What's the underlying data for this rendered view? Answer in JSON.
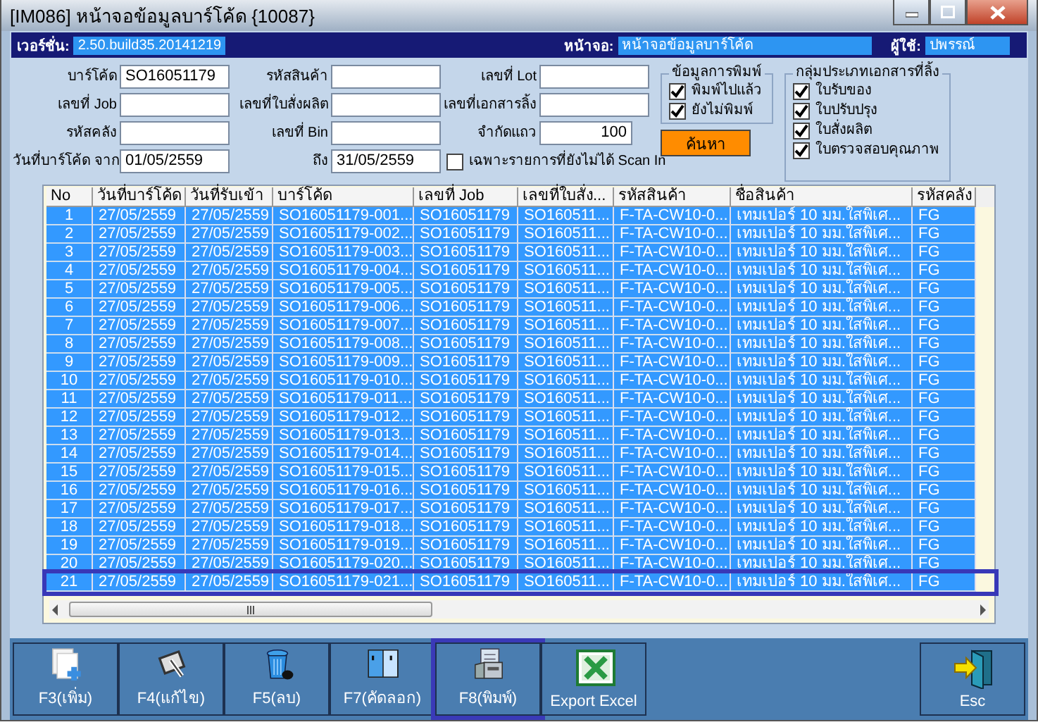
{
  "window": {
    "title": "[IM086] หน้าจอข้อมูลบาร์โค้ด {10087}"
  },
  "info_bar": [
    {
      "label": "เวอร์ชั่น:",
      "value": "2.50.build35.20141219"
    },
    {
      "label": "หน้าจอ:",
      "value": "หน้าจอข้อมูลบาร์โค้ด"
    },
    {
      "label": "ผู้ใช้:",
      "value": "ปพรรณ์"
    }
  ],
  "filters": [
    {
      "kind": "field",
      "label": "บาร์โค้ด",
      "value": "SO16051179"
    },
    {
      "kind": "field",
      "label": "รหัสสินค้า"
    },
    {
      "kind": "field",
      "label": "เลขที่ Lot"
    },
    {
      "kind": "field",
      "label": "เลขที่ Job"
    },
    {
      "kind": "field",
      "label": "เลขที่ใบสั่งผลิต"
    },
    {
      "kind": "field",
      "label": "เลขที่เอกสารลิ้ง"
    },
    {
      "kind": "field",
      "label": "รหัสคลัง"
    },
    {
      "kind": "field",
      "label": "เลขที่ Bin"
    },
    {
      "kind": "number",
      "label": "จำกัดแถว",
      "value": "100"
    },
    {
      "kind": "field",
      "label": "วันที่บาร์โค้ด จาก",
      "value": "01/05/2559"
    },
    {
      "kind": "field",
      "label": "ถึง",
      "value": "31/05/2559"
    },
    {
      "kind": "checkbox",
      "label": "เฉพาะรายการที่ยังไม่ได้ Scan In",
      "checked": false
    }
  ],
  "print_status": {
    "title": "ข้อมูลการพิมพ์",
    "options": [
      {
        "label": "พิมพ์ไปแล้ว",
        "checked": true
      },
      {
        "label": "ยังไม่พิมพ์",
        "checked": true
      }
    ]
  },
  "search_button": "ค้นหา",
  "document_types": {
    "title": "กลุ่มประเภทเอกสารที่ลิ้ง",
    "options": [
      {
        "label": "ใบรับของ",
        "checked": true
      },
      {
        "label": "ใบปรับปรุง",
        "checked": true
      },
      {
        "label": "ใบสั่งผลิต",
        "checked": true
      },
      {
        "label": "ใบตรวจสอบคุณภาพ",
        "checked": true
      }
    ]
  },
  "grid": {
    "columns": [
      "No",
      "วันที่บาร์โค้ด",
      "วันที่รับเข้า",
      "บาร์โค้ด",
      "เลขที่ Job",
      "เลขที่ใบสั่ง...",
      "รหัสสินค้า",
      "ชื่อสินค้า",
      "รหัสคลัง"
    ],
    "rows": [
      {
        "cells": [
          "1",
          "27/05/2559",
          "27/05/2559",
          "SO16051179-001...",
          "SO16051179",
          "SO160511...",
          "F-TA-CW10-0...",
          "เทมเปอร์ 10 มม.ใสพิเศ...",
          "FG"
        ],
        "selected": true,
        "highlighted": false
      },
      {
        "cells": [
          "2",
          "27/05/2559",
          "27/05/2559",
          "SO16051179-002...",
          "SO16051179",
          "SO160511...",
          "F-TA-CW10-0...",
          "เทมเปอร์ 10 มม.ใสพิเศ...",
          "FG"
        ],
        "selected": true,
        "highlighted": false
      },
      {
        "cells": [
          "3",
          "27/05/2559",
          "27/05/2559",
          "SO16051179-003...",
          "SO16051179",
          "SO160511...",
          "F-TA-CW10-0...",
          "เทมเปอร์ 10 มม.ใสพิเศ...",
          "FG"
        ],
        "selected": true,
        "highlighted": false
      },
      {
        "cells": [
          "4",
          "27/05/2559",
          "27/05/2559",
          "SO16051179-004...",
          "SO16051179",
          "SO160511...",
          "F-TA-CW10-0...",
          "เทมเปอร์ 10 มม.ใสพิเศ...",
          "FG"
        ],
        "selected": true,
        "highlighted": false
      },
      {
        "cells": [
          "5",
          "27/05/2559",
          "27/05/2559",
          "SO16051179-005...",
          "SO16051179",
          "SO160511...",
          "F-TA-CW10-0...",
          "เทมเปอร์ 10 มม.ใสพิเศ...",
          "FG"
        ],
        "selected": true,
        "highlighted": false
      },
      {
        "cells": [
          "6",
          "27/05/2559",
          "27/05/2559",
          "SO16051179-006...",
          "SO16051179",
          "SO160511...",
          "F-TA-CW10-0...",
          "เทมเปอร์ 10 มม.ใสพิเศ...",
          "FG"
        ],
        "selected": true,
        "highlighted": false
      },
      {
        "cells": [
          "7",
          "27/05/2559",
          "27/05/2559",
          "SO16051179-007...",
          "SO16051179",
          "SO160511...",
          "F-TA-CW10-0...",
          "เทมเปอร์ 10 มม.ใสพิเศ...",
          "FG"
        ],
        "selected": true,
        "highlighted": false
      },
      {
        "cells": [
          "8",
          "27/05/2559",
          "27/05/2559",
          "SO16051179-008...",
          "SO16051179",
          "SO160511...",
          "F-TA-CW10-0...",
          "เทมเปอร์ 10 มม.ใสพิเศ...",
          "FG"
        ],
        "selected": true,
        "highlighted": false
      },
      {
        "cells": [
          "9",
          "27/05/2559",
          "27/05/2559",
          "SO16051179-009...",
          "SO16051179",
          "SO160511...",
          "F-TA-CW10-0...",
          "เทมเปอร์ 10 มม.ใสพิเศ...",
          "FG"
        ],
        "selected": true,
        "highlighted": false
      },
      {
        "cells": [
          "10",
          "27/05/2559",
          "27/05/2559",
          "SO16051179-010...",
          "SO16051179",
          "SO160511...",
          "F-TA-CW10-0...",
          "เทมเปอร์ 10 มม.ใสพิเศ...",
          "FG"
        ],
        "selected": true,
        "highlighted": false
      },
      {
        "cells": [
          "11",
          "27/05/2559",
          "27/05/2559",
          "SO16051179-011...",
          "SO16051179",
          "SO160511...",
          "F-TA-CW10-0...",
          "เทมเปอร์ 10 มม.ใสพิเศ...",
          "FG"
        ],
        "selected": true,
        "highlighted": false
      },
      {
        "cells": [
          "12",
          "27/05/2559",
          "27/05/2559",
          "SO16051179-012...",
          "SO16051179",
          "SO160511...",
          "F-TA-CW10-0...",
          "เทมเปอร์ 10 มม.ใสพิเศ...",
          "FG"
        ],
        "selected": true,
        "highlighted": false
      },
      {
        "cells": [
          "13",
          "27/05/2559",
          "27/05/2559",
          "SO16051179-013...",
          "SO16051179",
          "SO160511...",
          "F-TA-CW10-0...",
          "เทมเปอร์ 10 มม.ใสพิเศ...",
          "FG"
        ],
        "selected": true,
        "highlighted": false
      },
      {
        "cells": [
          "14",
          "27/05/2559",
          "27/05/2559",
          "SO16051179-014...",
          "SO16051179",
          "SO160511...",
          "F-TA-CW10-0...",
          "เทมเปอร์ 10 มม.ใสพิเศ...",
          "FG"
        ],
        "selected": true,
        "highlighted": false
      },
      {
        "cells": [
          "15",
          "27/05/2559",
          "27/05/2559",
          "SO16051179-015...",
          "SO16051179",
          "SO160511...",
          "F-TA-CW10-0...",
          "เทมเปอร์ 10 มม.ใสพิเศ...",
          "FG"
        ],
        "selected": true,
        "highlighted": false
      },
      {
        "cells": [
          "16",
          "27/05/2559",
          "27/05/2559",
          "SO16051179-016...",
          "SO16051179",
          "SO160511...",
          "F-TA-CW10-0...",
          "เทมเปอร์ 10 มม.ใสพิเศ...",
          "FG"
        ],
        "selected": true,
        "highlighted": false
      },
      {
        "cells": [
          "17",
          "27/05/2559",
          "27/05/2559",
          "SO16051179-017...",
          "SO16051179",
          "SO160511...",
          "F-TA-CW10-0...",
          "เทมเปอร์ 10 มม.ใสพิเศ...",
          "FG"
        ],
        "selected": true,
        "highlighted": false
      },
      {
        "cells": [
          "18",
          "27/05/2559",
          "27/05/2559",
          "SO16051179-018...",
          "SO16051179",
          "SO160511...",
          "F-TA-CW10-0...",
          "เทมเปอร์ 10 มม.ใสพิเศ...",
          "FG"
        ],
        "selected": true,
        "highlighted": false
      },
      {
        "cells": [
          "19",
          "27/05/2559",
          "27/05/2559",
          "SO16051179-019...",
          "SO16051179",
          "SO160511...",
          "F-TA-CW10-0...",
          "เทมเปอร์ 10 มม.ใสพิเศ...",
          "FG"
        ],
        "selected": true,
        "highlighted": false
      },
      {
        "cells": [
          "20",
          "27/05/2559",
          "27/05/2559",
          "SO16051179-020...",
          "SO16051179",
          "SO160511...",
          "F-TA-CW10-0...",
          "เทมเปอร์ 10 มม.ใสพิเศ...",
          "FG"
        ],
        "selected": true,
        "highlighted": false
      },
      {
        "cells": [
          "21",
          "27/05/2559",
          "27/05/2559",
          "SO16051179-021...",
          "SO16051179",
          "SO160511...",
          "F-TA-CW10-0...",
          "เทมเปอร์ 10 มม.ใสพิเศ...",
          "FG"
        ],
        "selected": true,
        "highlighted": true
      }
    ]
  },
  "toolbar": [
    {
      "kind": "add",
      "label": "F3(เพิ่ม)",
      "highlighted": false
    },
    {
      "kind": "edit",
      "label": "F4(แก้ไข)",
      "highlighted": false
    },
    {
      "kind": "delete",
      "label": "F5(ลบ)",
      "highlighted": false
    },
    {
      "kind": "copy",
      "label": "F7(คัดลอก)",
      "highlighted": false
    },
    {
      "kind": "print",
      "label": "F8(พิมพ์)",
      "highlighted": true
    },
    {
      "kind": "excel",
      "label": "Export Excel",
      "highlighted": false
    },
    {
      "kind": "exit",
      "label": "Esc",
      "highlighted": false
    }
  ]
}
